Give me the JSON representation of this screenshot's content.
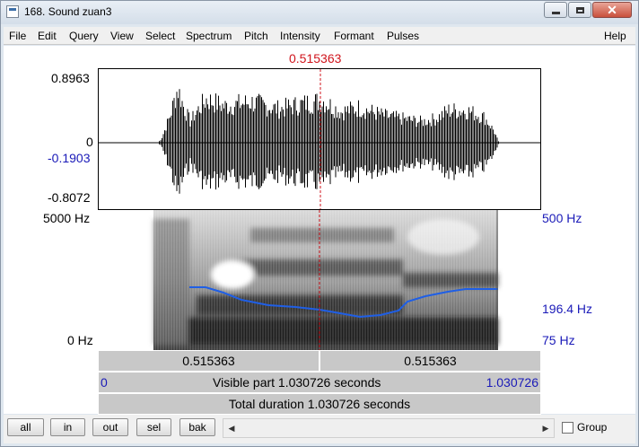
{
  "window": {
    "title": "168. Sound zuan3",
    "close_glyph": "✕"
  },
  "menu": {
    "items": [
      "File",
      "Edit",
      "Query",
      "View",
      "Select",
      "Spectrum",
      "Pitch",
      "Intensity",
      "Formant",
      "Pulses"
    ],
    "help": "Help"
  },
  "cursor": {
    "time": "0.515363"
  },
  "waveform": {
    "max_label": "0.8963",
    "zero_label": "0",
    "cursor_value_label": "-0.1903",
    "min_label": "-0.8072"
  },
  "spectrogram": {
    "freq_top": "5000 Hz",
    "freq_bottom": "0 Hz",
    "pitch_top": "500 Hz",
    "pitch_cursor": "196.4 Hz",
    "pitch_bottom": "75 Hz",
    "pitch_color": "#1f5fe6"
  },
  "time_bars": {
    "left_segment": "0.515363",
    "right_segment": "0.515363",
    "visible_start": "0",
    "visible_part": "Visible part 1.030726 seconds",
    "visible_end": "1.030726",
    "total_duration": "Total duration 1.030726 seconds"
  },
  "buttons": {
    "all": "all",
    "in": "in",
    "out": "out",
    "sel": "sel",
    "bak": "bak"
  },
  "scroll": {
    "left_arrow": "◀",
    "right_arrow": "▶"
  },
  "group_label": "Group"
}
